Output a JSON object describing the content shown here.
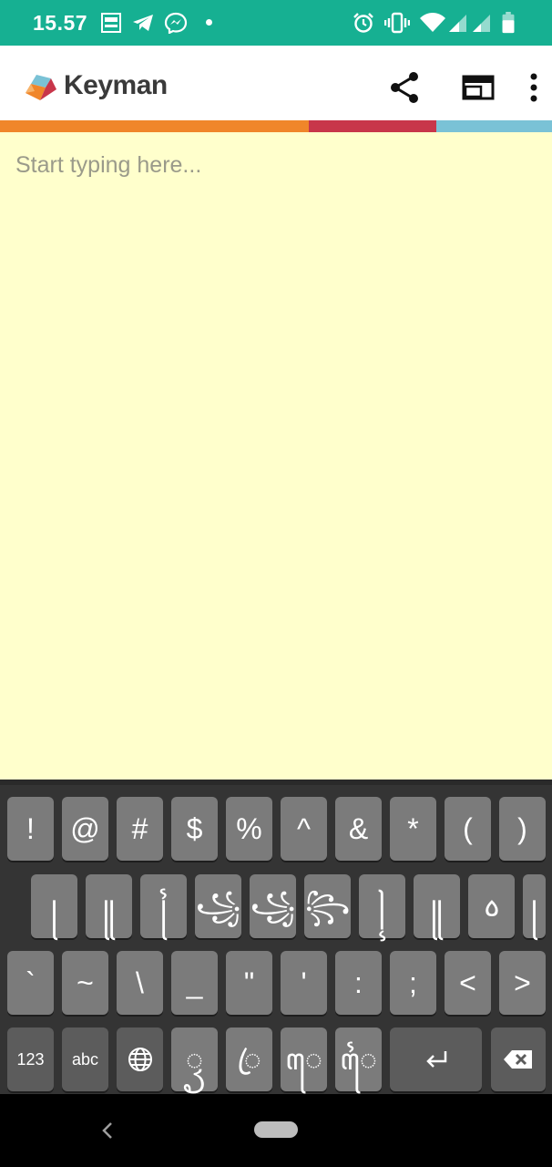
{
  "status_bar": {
    "time": "15.57",
    "icons": [
      "jazz-app-icon",
      "telegram-icon",
      "messenger-icon",
      "notification-dot",
      "alarm-icon",
      "vibrate-icon",
      "wifi-icon",
      "signal-icon",
      "signal-icon-2",
      "battery-icon"
    ],
    "background_color": "#16b092"
  },
  "app_bar": {
    "title": "Keyman",
    "actions": [
      "share-icon",
      "web-browser-icon",
      "more-vert-icon"
    ]
  },
  "color_strip": [
    "#f0862a",
    "#c8364a",
    "#7ac2d6"
  ],
  "editor": {
    "placeholder": "Start typing here...",
    "value": "",
    "background_color": "#ffffcc"
  },
  "keyboard": {
    "row1": [
      "!",
      "@",
      "#",
      "$",
      "%",
      "^",
      "&",
      "*",
      "(",
      ")"
    ],
    "row2": [
      "꧊",
      "꧋",
      "꧌",
      "꧁",
      "꧁",
      "꧂",
      "꧍",
      "꧋",
      "꧞",
      "꧊"
    ],
    "row3": [
      "`",
      "~",
      "\\",
      "_",
      "\"",
      "'",
      ":",
      ";",
      "<",
      ">"
    ],
    "row4": {
      "numbers": "123",
      "abc": "abc",
      "globe": "globe-icon",
      "k1": "ꦽ",
      "k2": "ꦿ",
      "k3": "ꦺ",
      "k4": "ꦻ",
      "enter": "enter-icon",
      "backspace": "backspace-icon"
    }
  },
  "nav_bar": {
    "back": "back-icon",
    "home": "home-pill"
  }
}
